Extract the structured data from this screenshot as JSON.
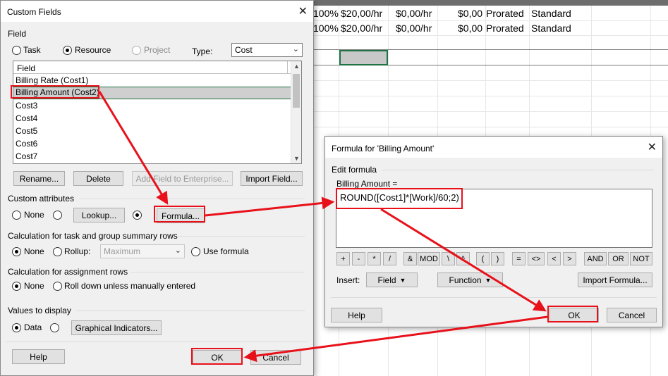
{
  "sheet": {
    "rows": [
      [
        "100%",
        "$20,00/hr",
        "$0,00/hr",
        "$0,00",
        "Prorated",
        "Standard"
      ],
      [
        "100%",
        "$20,00/hr",
        "$0,00/hr",
        "$0,00",
        "Prorated",
        "Standard"
      ]
    ]
  },
  "custom_fields": {
    "title": "Custom Fields",
    "close": "✕",
    "field_label": "Field",
    "task": "Task",
    "resource": "Resource",
    "project": "Project",
    "type_label": "Type:",
    "type_value": "Cost",
    "list_header": "Field",
    "items": [
      "Billing Rate (Cost1)",
      "Billing Amount (Cost2)",
      "Cost3",
      "Cost4",
      "Cost5",
      "Cost6",
      "Cost7"
    ],
    "rename": "Rename...",
    "delete": "Delete",
    "add_enterprise": "Add Field to Enterprise...",
    "import_field": "Import Field...",
    "custom_attributes": "Custom attributes",
    "none": "None",
    "lookup": "Lookup...",
    "formula": "Formula...",
    "calc_task": "Calculation for task and group summary rows",
    "rollup": "Rollup:",
    "rollup_value": "Maximum",
    "use_formula": "Use formula",
    "calc_assign": "Calculation for assignment rows",
    "roll_down": "Roll down unless manually entered",
    "values_display": "Values to display",
    "data": "Data",
    "graphical": "Graphical Indicators...",
    "help": "Help",
    "ok": "OK",
    "cancel": "Cancel"
  },
  "formula_dialog": {
    "title": "Formula for 'Billing Amount'",
    "close": "✕",
    "edit_formula": "Edit formula",
    "expr_label": "Billing Amount =",
    "expr": "ROUND([Cost1]*[Work]/60;2)",
    "ops": [
      "+",
      "-",
      "*",
      "/",
      "&",
      "MOD",
      "\\",
      "^",
      "(",
      ")",
      "=",
      "<>",
      "<",
      ">",
      "AND",
      "OR",
      "NOT"
    ],
    "insert": "Insert:",
    "field": "Field",
    "function": "Function",
    "import_formula": "Import Formula...",
    "help": "Help",
    "ok": "OK",
    "cancel": "Cancel"
  },
  "colors": {
    "annotation": "#e8111a",
    "accent": "#217346"
  }
}
